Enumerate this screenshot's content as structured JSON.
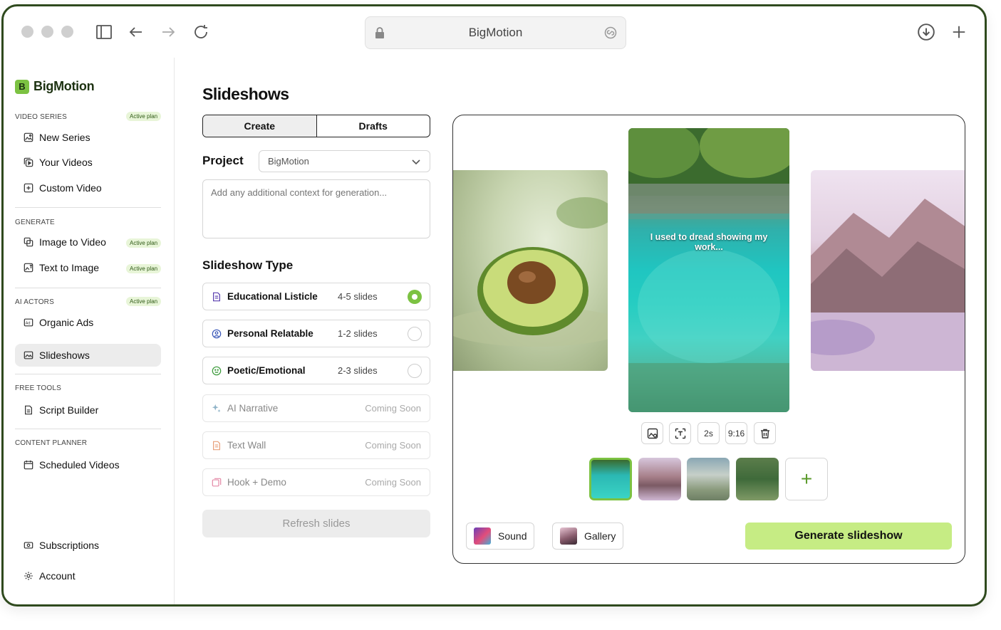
{
  "browser": {
    "address": "BigMotion"
  },
  "sidebar": {
    "brand": "BigMotion",
    "sections": {
      "video_series": "VIDEO SERIES",
      "generate": "GENERATE",
      "ai_actors": "AI ACTORS",
      "free_tools": "FREE TOOLS",
      "content_planner": "CONTENT PLANNER"
    },
    "badge": "Active plan",
    "items": {
      "new_series": "New Series",
      "your_videos": "Your Videos",
      "custom_video": "Custom Video",
      "image_to_video": "Image to Video",
      "text_to_image": "Text to Image",
      "organic_ads": "Organic Ads",
      "slideshows": "Slideshows",
      "script_builder": "Script Builder",
      "scheduled_videos": "Scheduled Videos",
      "subscriptions": "Subscriptions",
      "account": "Account"
    }
  },
  "main": {
    "title": "Slideshows",
    "tabs": {
      "create": "Create",
      "drafts": "Drafts"
    },
    "project_label": "Project",
    "project_value": "BigMotion",
    "context_placeholder": "Add any additional context for generation...",
    "slideshow_type_title": "Slideshow Type",
    "types": [
      {
        "name": "Educational Listicle",
        "slides": "4-5 slides",
        "selected": true
      },
      {
        "name": "Personal Relatable",
        "slides": "1-2 slides",
        "selected": false
      },
      {
        "name": "Poetic/Emotional",
        "slides": "2-3 slides",
        "selected": false
      },
      {
        "name": "AI Narrative",
        "status": "Coming Soon"
      },
      {
        "name": "Text Wall",
        "status": "Coming Soon"
      },
      {
        "name": "Hook + Demo",
        "status": "Coming Soon"
      }
    ],
    "refresh_label": "Refresh slides"
  },
  "preview": {
    "caption": "I used to dread showing my work...",
    "duration": "2s",
    "aspect": "9:16",
    "sound_label": "Sound",
    "gallery_label": "Gallery",
    "generate_label": "Generate slideshow",
    "add_label": "+"
  },
  "colors": {
    "accent": "#7cc242",
    "generate_bg": "#c6ec84",
    "brand_dark": "#1d3211",
    "window_border": "#2f4a1e"
  }
}
